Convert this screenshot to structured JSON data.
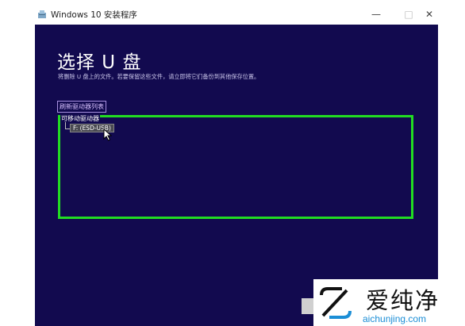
{
  "window": {
    "title": "Windows 10 安装程序",
    "icon": "setup-icon",
    "controls": {
      "minimize": "—",
      "maximize": "□",
      "close": "✕"
    }
  },
  "main": {
    "heading": "选择 U 盘",
    "subtitle": "将删除 U 盘上的文件。若要保留这些文件，请立即将它们备份到其他保存位置。",
    "refresh_link": "刷新驱动器列表",
    "drive_group_label": "可移动驱动器",
    "drives": [
      {
        "label": "F: (ESD-USB)",
        "selected": true
      }
    ],
    "highlight_color": "#22dd22"
  },
  "watermark": {
    "name": "爱纯净",
    "url": "aichunjing.com",
    "accent_color": "#1b8ed6"
  },
  "colors": {
    "background": "#120a4f",
    "text": "#ffffff"
  }
}
